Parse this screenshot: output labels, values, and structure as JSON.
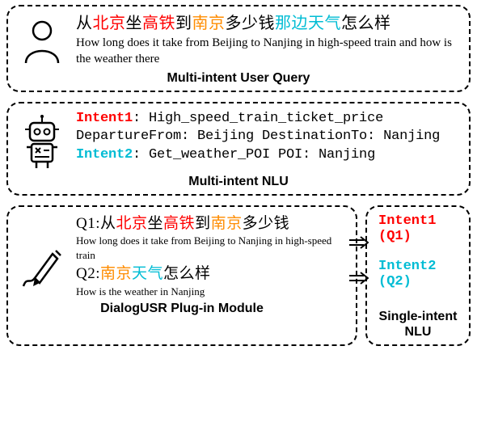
{
  "panel1": {
    "caption": "Multi-intent User Query",
    "zh_parts": {
      "p0": "从",
      "p1": "北京",
      "p2": "坐",
      "p3": "高铁",
      "p4": "到",
      "p5": "南京",
      "p6": "多少钱",
      "p7": "那边天气",
      "p8": "怎么样"
    },
    "en": "How long does it take from Beijing to Nanjing in high-speed train and how is the weather there"
  },
  "panel2": {
    "caption": "Multi-intent NLU",
    "intent1_label": "Intent1",
    "intent1_value": ": High_speed_train_ticket_price",
    "line2": "DepartureFrom: Beijing DestinationTo: Nanjing",
    "intent2_label": "Intent2",
    "intent2_value": ": Get_weather_POI  POI: Nanjing"
  },
  "panel3": {
    "caption_left": "DialogUSR Plug-in Module",
    "caption_right_a": "Single-intent",
    "caption_right_b": "NLU",
    "q1_prefix": "Q1:",
    "q1_zh": {
      "p1": "从",
      "p2": "北京",
      "p3": "坐",
      "p4": "高铁",
      "p5": "到",
      "p6": "南京",
      "p7": "多少钱"
    },
    "q1_en": "How long does it take from Beijing to Nanjing in high-speed train",
    "q2_prefix": "Q2:",
    "q2_zh": {
      "p1": "南京",
      "p2": "天气",
      "p3": "怎么样"
    },
    "q2_en": "How is the weather in Nanjing",
    "right_intent1": "Intent1 (Q1)",
    "right_intent2": "Intent2 (Q2)"
  }
}
